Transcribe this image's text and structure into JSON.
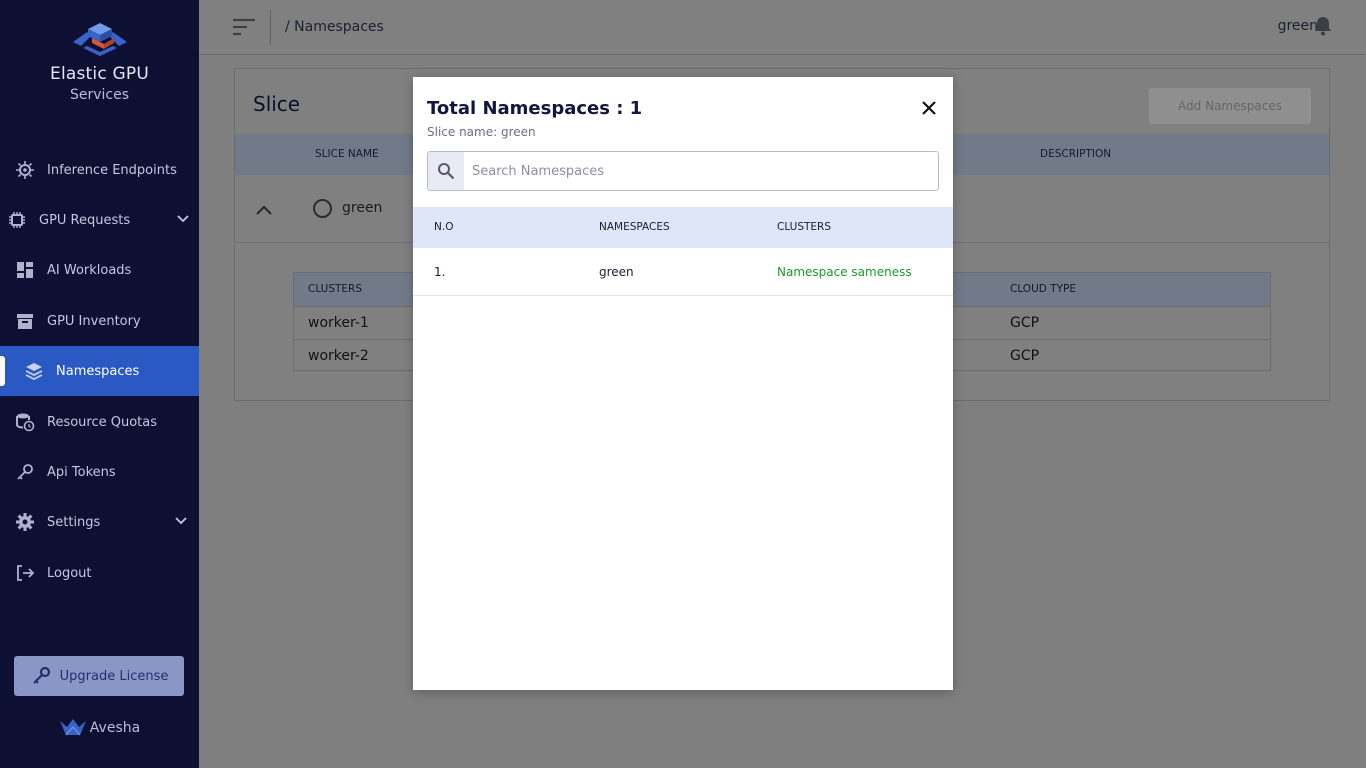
{
  "sidebar": {
    "logo_line1": "Elastic GPU",
    "logo_line2": "Services",
    "items": [
      {
        "label": "Inference Endpoints",
        "icon": "chip-gear-icon"
      },
      {
        "label": "GPU Requests",
        "icon": "chip-icon",
        "expandable": true
      },
      {
        "label": "AI Workloads",
        "icon": "dashboard-icon"
      },
      {
        "label": "GPU Inventory",
        "icon": "archive-icon"
      },
      {
        "label": "Namespaces",
        "icon": "layers-icon",
        "active": true
      },
      {
        "label": "Resource Quotas",
        "icon": "database-clock-icon"
      },
      {
        "label": "Api Tokens",
        "icon": "key-icon"
      },
      {
        "label": "Settings",
        "icon": "gear-icon",
        "expandable": true
      },
      {
        "label": "Logout",
        "icon": "logout-icon"
      }
    ],
    "upgrade_label": "Upgrade License",
    "brand": "Avesha"
  },
  "header": {
    "breadcrumb": "/ Namespaces",
    "user": "green"
  },
  "background_page": {
    "title": "Slice",
    "add_button": "Add Namespaces",
    "columns": [
      "SLICE NAME",
      "DESCRIPTION"
    ],
    "slice_row": {
      "name": "green"
    },
    "inner_columns": [
      "CLUSTERS",
      "CLOUD TYPE"
    ],
    "inner_rows": [
      {
        "cluster": "worker-1",
        "cloud": "GCP"
      },
      {
        "cluster": "worker-2",
        "cloud": "GCP"
      }
    ]
  },
  "modal": {
    "title": "Total Namespaces : 1",
    "subtitle": "Slice name: green",
    "search_placeholder": "Search Namespaces",
    "columns": [
      "N.O",
      "NAMESPACES",
      "CLUSTERS"
    ],
    "rows": [
      {
        "no": "1.",
        "namespace": "green",
        "clusters": "Namespace sameness"
      }
    ]
  },
  "colors": {
    "sidebar_bg": "#0d1033",
    "active_item": "#2b59c3",
    "modal_header_bg": "#dfe6f8",
    "link_green": "#1a9a2a"
  }
}
